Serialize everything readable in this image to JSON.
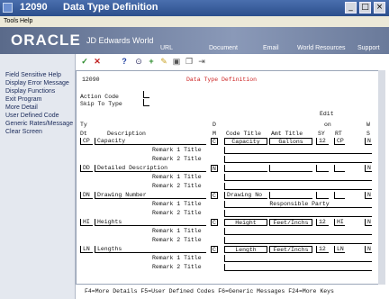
{
  "window": {
    "number": "12090",
    "title": "Data Type Definition",
    "buttons": [
      "_",
      "□",
      "×"
    ]
  },
  "menu": [
    "Tools",
    "Help"
  ],
  "banner": {
    "brand": "ORACLE",
    "product": "JD Edwards World",
    "nav": [
      "URL",
      "Document",
      "Email",
      "World Resources",
      "Support"
    ]
  },
  "toolbar_icons": [
    "check-icon",
    "cancel-icon",
    "help-icon",
    "zoom-icon",
    "add-icon",
    "edit-icon",
    "delete-icon",
    "copy-icon",
    "exit-icon"
  ],
  "sidebar": [
    "Field Sensitive Help",
    "Display Error Message",
    "Display Functions",
    "Exit Program",
    "More Detail",
    "User Defined Code",
    "Generic Rates/Message",
    "Clear Screen"
  ],
  "form": {
    "program_id": "12090",
    "heading": "Data Type Definition",
    "action_code_label": "Action Code",
    "skip_to_type_label": "Skip To Type",
    "col": {
      "ty": "Ty",
      "dt": "Dt",
      "description": "Description",
      "d": "D",
      "m": "M",
      "code_title": "Code Title",
      "amt_title": "Amt Title",
      "edit": "Edit",
      "on": "on",
      "sy": "SY",
      "rt": "RT",
      "w": "W",
      "s": "S"
    },
    "remark1": "Remark 1 Title",
    "remark2": "Remark 2 Title",
    "rows": [
      {
        "ty": "CP",
        "desc": "Capacity",
        "dm": "C",
        "code_title": "Capacity",
        "amt_title": "Gallons",
        "sy": "12",
        "rt": "CP",
        "ws": "N",
        "remark1": "",
        "remark2": ""
      },
      {
        "ty": "DD",
        "desc": "Detailed Description",
        "dm": "N",
        "code_title": "",
        "amt_title": "",
        "sy": "",
        "rt": "",
        "ws": "N",
        "remark1": "",
        "remark2": ""
      },
      {
        "ty": "DN",
        "desc": "Drawing Number",
        "dm": "C",
        "code_title": "Drawing No",
        "amt_title": "",
        "sy": "",
        "rt": "",
        "ws": "N",
        "remark1": "Responsible Party",
        "remark2": ""
      },
      {
        "ty": "HI",
        "desc": "Heights",
        "dm": "C",
        "code_title": "Height",
        "amt_title": "Feet/Inchs",
        "sy": "12",
        "rt": "HI",
        "ws": "N",
        "remark1": "",
        "remark2": ""
      },
      {
        "ty": "LN",
        "desc": "Lengths",
        "dm": "C",
        "code_title": "Length",
        "amt_title": "Feet/Inchs",
        "sy": "12",
        "rt": "LN",
        "ws": "N",
        "remark1": "",
        "remark2": ""
      }
    ],
    "fkeys": "F4=More Details  F5=User Defined Codes  F6=Generic Messages  F24=More Keys"
  }
}
